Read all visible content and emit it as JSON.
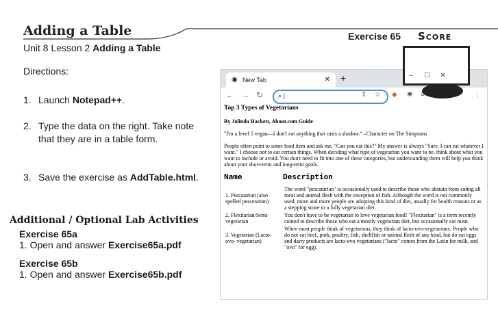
{
  "header": {
    "title": "Adding a Table",
    "subtitle_prefix": "Unit 8 Lesson 2",
    "subtitle_bold": "Adding a Table",
    "exercise": "Exercise 65",
    "score": "Score"
  },
  "directions": {
    "label": "Directions:",
    "steps": [
      {
        "num": "1.",
        "pre": "Launch ",
        "bold": "Notepad++",
        "post": "."
      },
      {
        "num": "2.",
        "pre": "Type the data on the right. Take note that they are in a table form.",
        "bold": "",
        "post": ""
      },
      {
        "num": "3.",
        "pre": "Save the exercise as ",
        "bold": "AddTable.html",
        "post": "."
      }
    ]
  },
  "additional": {
    "heading": "Additional / Optional Lab Activities",
    "items": [
      {
        "title": "Exercise 65a",
        "num": "1.",
        "pre": "Open and answer ",
        "bold": "Exercise65a.pdf"
      },
      {
        "title": "Exercise 65b",
        "num": "1.",
        "pre": "Open and answer ",
        "bold": "Exercise65b.pdf"
      }
    ]
  },
  "browser": {
    "tab_label": "New Tab",
    "page": {
      "heading": "Top 3 Types of Vegetarians",
      "byline": "By Jolinda Hackett, About.com Guide",
      "quote": "\"I'm a level 5 vegan—I don't eat anything that casts a shadow.\" –Character on The Simpsons",
      "paragraph": "People often point to some food item and ask me, \"Can you eat this?\" My answer is always \"Sure, I can eat whatever I want.\" I choose not to eat certain things. When deciding what type of vegetarian you want to be, think about what you want to include or avoid. You don't need to fit into one of these categories, but understanding them will help you think about your short-term and long-term goals.",
      "table_headers": [
        "Name",
        "Description"
      ],
      "rows": [
        {
          "name": "1. Pescatarian (also spelled pescetarian)",
          "desc": "The word \"pescatarian\" is occasionally used to describe those who abstain from eating all meat and animal flesh with the exception of fish. Although the word is not commonly used, more and more people are adopting this kind of diet, usually for health reasons or as a stepping stone to a fully vegetarian diet."
        },
        {
          "name": "2. Flexitarian/Semi-vegetarian",
          "desc": "You don't have to be vegetarian to love vegetarian food! \"Flexitarian\" is a term recently coined to describe those who eat a mostly vegetarian diet, but occasionally eat meat."
        },
        {
          "name": "3. Vegetarian (Lacto-ovo- vegetarian)",
          "desc": "When most people think of vegetarians, they think of lacto-ovo-vegetarians. People who do not eat beef, pork, poultry, fish, shellfish or animal flesh of any kind, but do eat eggs and dairy products are lacto-ovo vegetarians (\"lacto\" comes from the Latin for milk, and \"ovo\" for egg)."
        }
      ]
    }
  }
}
